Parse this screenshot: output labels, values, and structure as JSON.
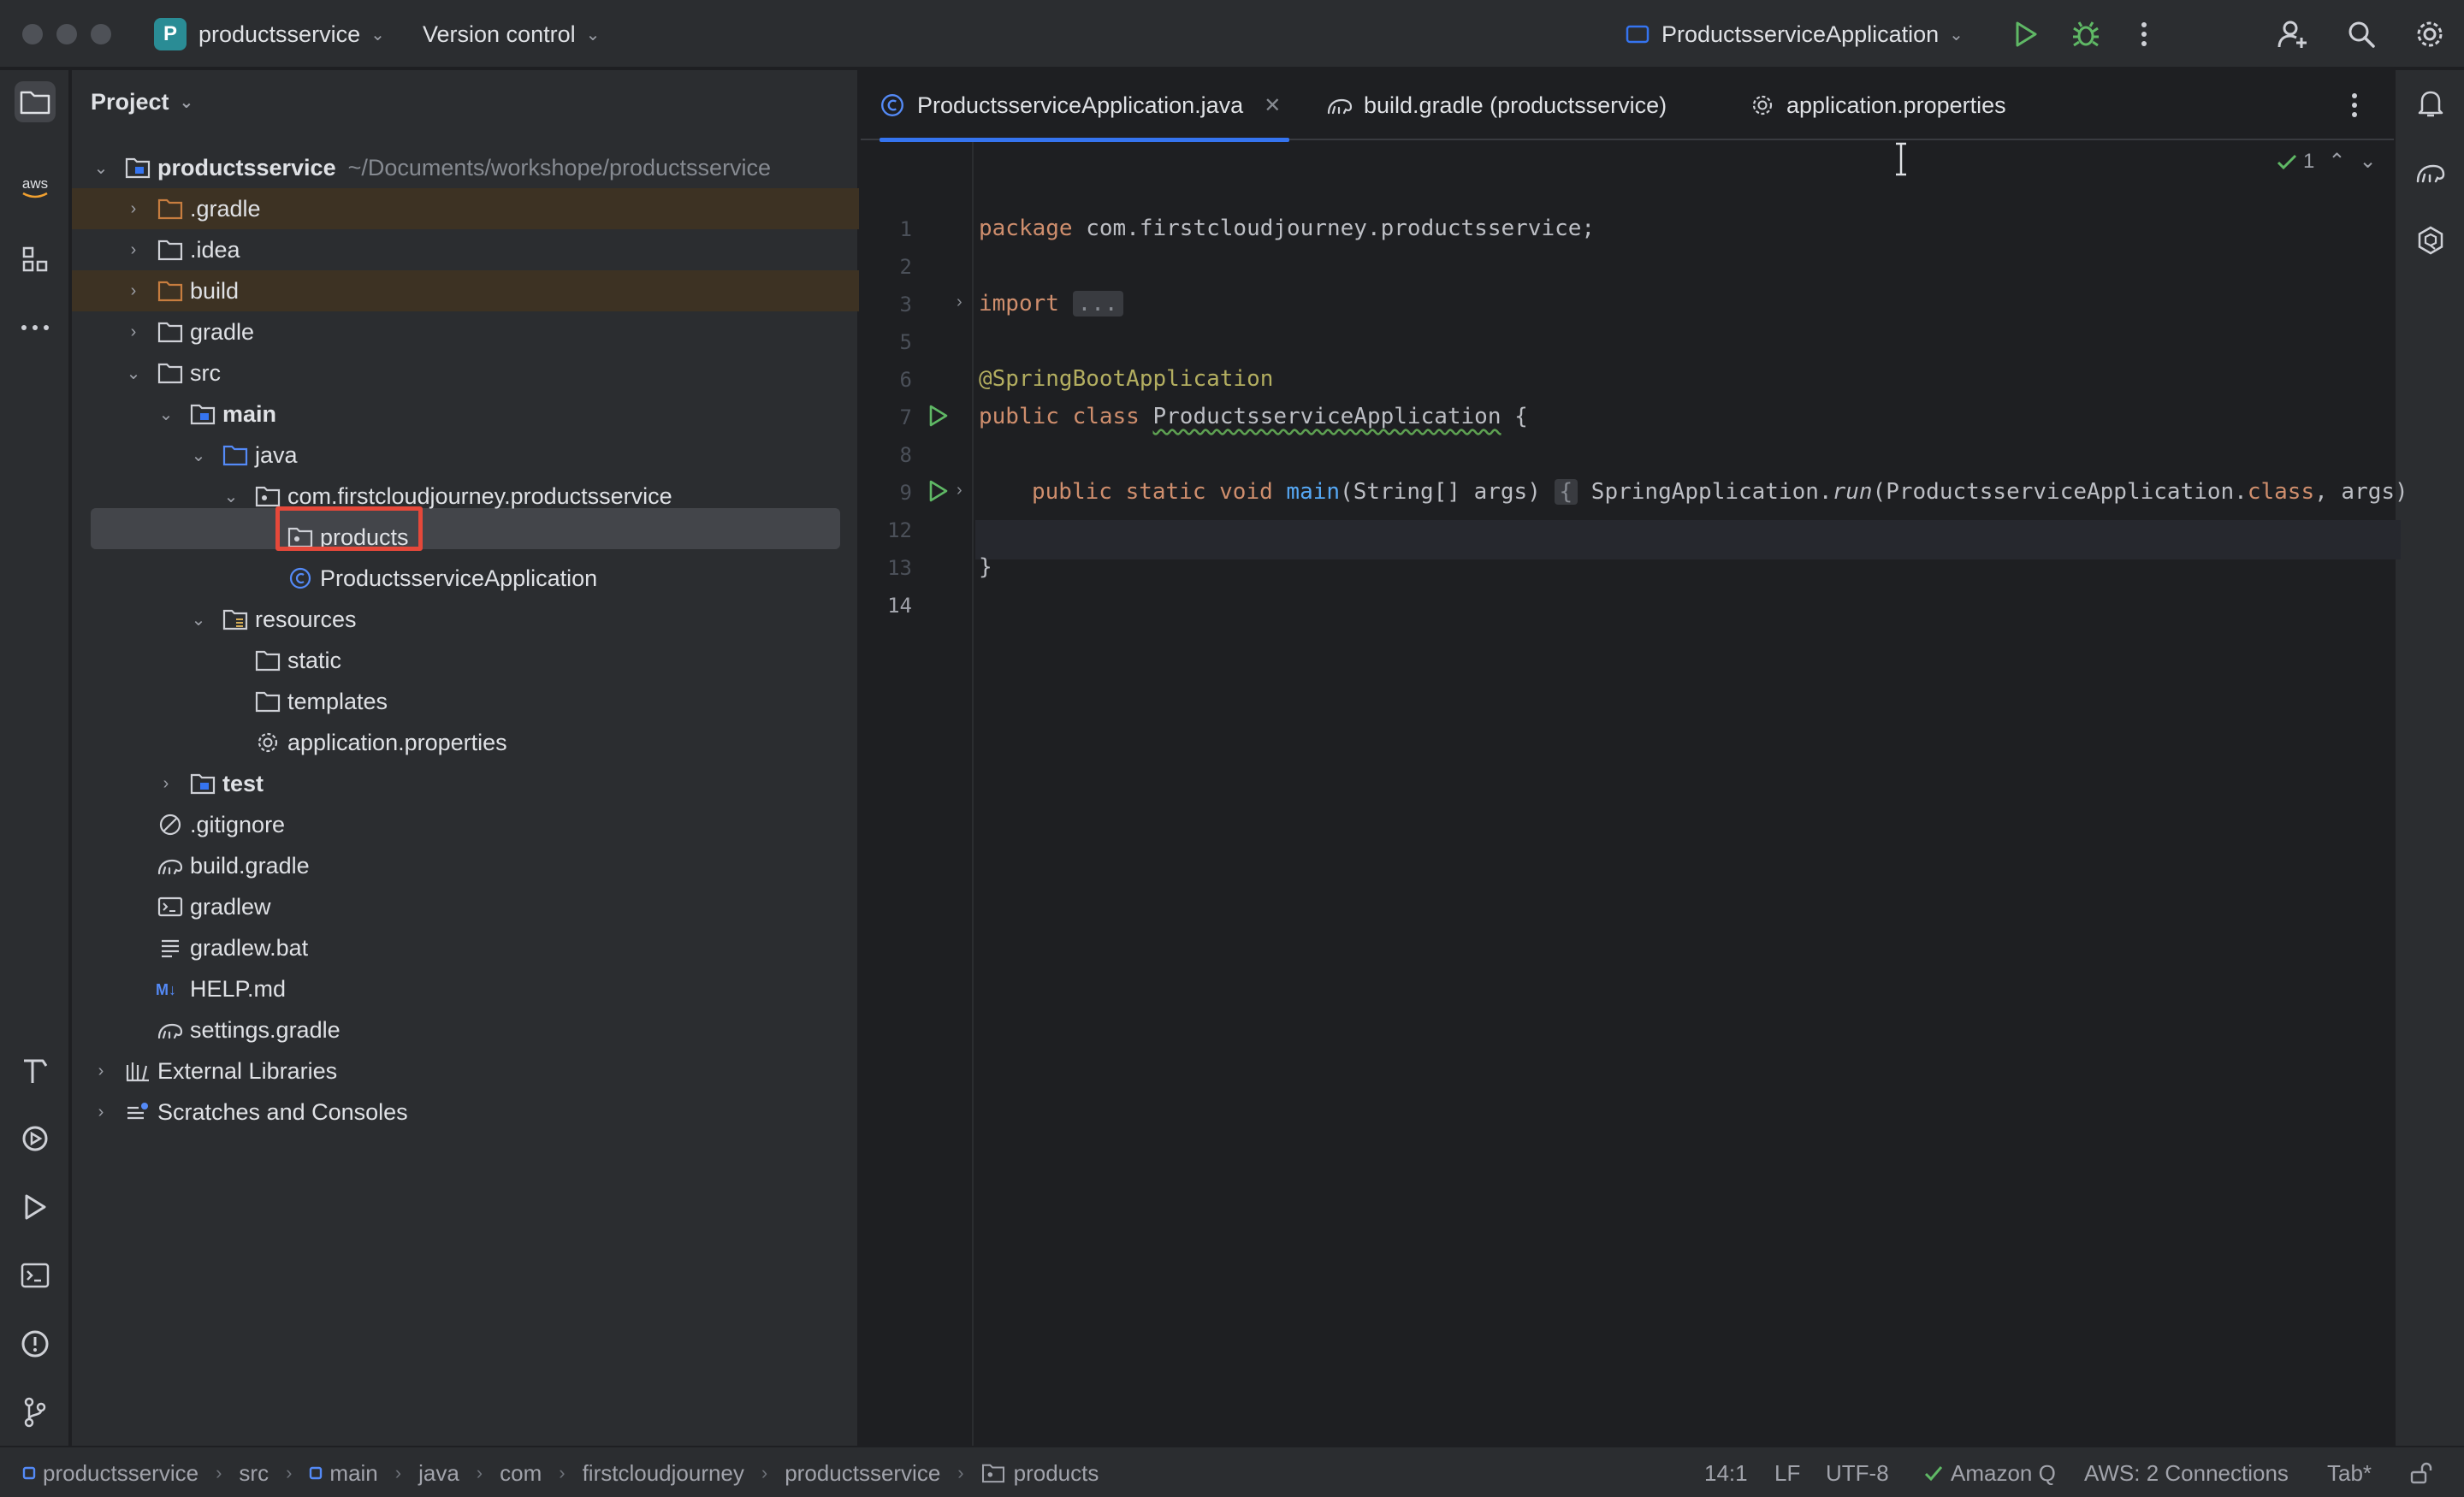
{
  "titlebar": {
    "project_badge": "P",
    "project_name": "productsservice",
    "vcs": "Version control",
    "run_config": "ProductsserviceApplication"
  },
  "project_panel": {
    "header": "Project",
    "tree": [
      {
        "label": "productsservice",
        "path": "~/Documents/workshope/productsservice"
      },
      {
        "label": ".gradle"
      },
      {
        "label": ".idea"
      },
      {
        "label": "build"
      },
      {
        "label": "gradle"
      },
      {
        "label": "src"
      },
      {
        "label": "main"
      },
      {
        "label": "java"
      },
      {
        "label": "com.firstcloudjourney.productsservice"
      },
      {
        "label": "products"
      },
      {
        "label": "ProductsserviceApplication"
      },
      {
        "label": "resources"
      },
      {
        "label": "static"
      },
      {
        "label": "templates"
      },
      {
        "label": "application.properties"
      },
      {
        "label": "test"
      },
      {
        "label": ".gitignore"
      },
      {
        "label": "build.gradle"
      },
      {
        "label": "gradlew"
      },
      {
        "label": "gradlew.bat"
      },
      {
        "label": "HELP.md"
      },
      {
        "label": "settings.gradle"
      },
      {
        "label": "External Libraries"
      },
      {
        "label": "Scratches and Consoles"
      }
    ]
  },
  "editor": {
    "tabs": [
      {
        "label": "ProductsserviceApplication.java"
      },
      {
        "label": "build.gradle (productsservice)"
      },
      {
        "label": "application.properties"
      }
    ],
    "line_numbers": [
      "1",
      "2",
      "3",
      "5",
      "6",
      "7",
      "8",
      "9",
      "12",
      "13",
      "14"
    ],
    "inspection_count": "1",
    "code": {
      "l1_kw": "package",
      "l1_rest": " com.firstcloudjourney.productsservice;",
      "l3_kw": "import",
      "l3_fold": "...",
      "l6_ann": "@SpringBootApplication",
      "l7_kw": "public class",
      "l7_name": "ProductsserviceApplication",
      "l7_rest": " {",
      "l9_kw": "public static void",
      "l9_fn": "main",
      "l9_args": "(String[] args) ",
      "l9_brace": "{",
      "l9_call": " SpringApplication.",
      "l9_run": "run",
      "l9_args2": "(ProductsserviceApplication.",
      "l9_class_kw": "class",
      "l9_end": ", args)",
      "l13": "}"
    }
  },
  "status_bar": {
    "breadcrumbs": [
      "productsservice",
      "src",
      "main",
      "java",
      "com",
      "firstcloudjourney",
      "productsservice",
      "products"
    ],
    "position": "14:1",
    "line_sep": "LF",
    "encoding": "UTF-8",
    "amazon_q": "Amazon Q",
    "aws": "AWS: 2 Connections",
    "indent": "Tab*"
  },
  "colors": {
    "accent": "#3574f0",
    "highlight_box": "#e5483a",
    "run_green": "#5fb865",
    "folder_orange": "#c77d3f"
  }
}
